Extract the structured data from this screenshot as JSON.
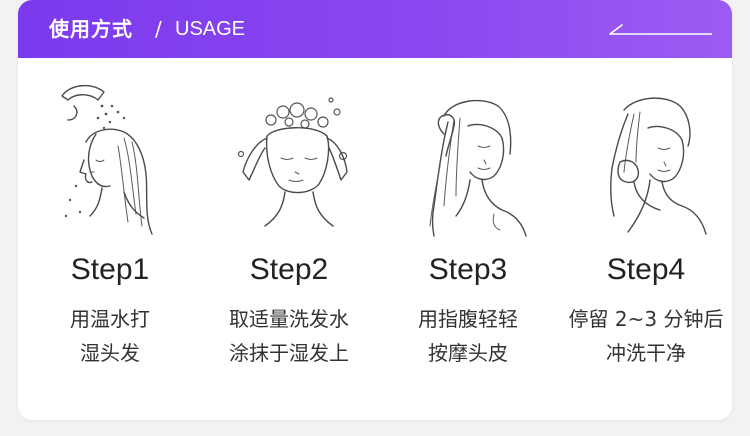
{
  "header": {
    "title_cn": "使用方式",
    "separator": "/",
    "title_en": "USAGE",
    "accent_from": "#7c3aed",
    "accent_to": "#9c5cf2"
  },
  "steps": [
    {
      "label": "Step1",
      "line1": "用温水打",
      "line2": "湿头发",
      "icon": "shower-head-rinse-illustration"
    },
    {
      "label": "Step2",
      "line1": "取适量洗发水",
      "line2": "涂抹于湿发上",
      "icon": "shampoo-lather-illustration"
    },
    {
      "label": "Step3",
      "line1": "用指腹轻轻",
      "line2": "按摩头皮",
      "icon": "scalp-massage-illustration"
    },
    {
      "label": "Step4",
      "line1": "停留 2~3 分钟后",
      "line2": "冲洗干净",
      "icon": "rinse-hair-illustration"
    }
  ]
}
